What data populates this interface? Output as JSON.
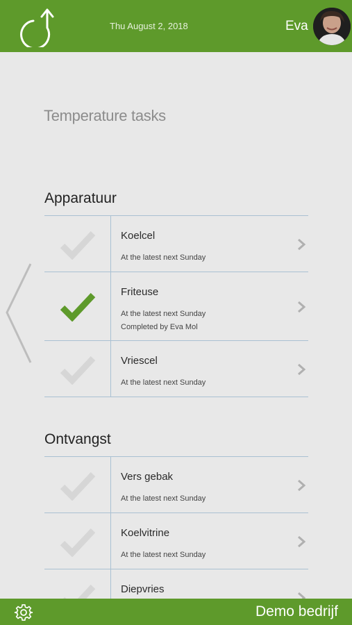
{
  "header": {
    "date": "Thu August 2, 2018",
    "user_name": "Eva",
    "logo_icon": "app-logo-icon",
    "avatar_icon": "user-avatar-photo"
  },
  "page": {
    "title": "Temperature tasks"
  },
  "sections": [
    {
      "title": "Apparatuur",
      "tasks": [
        {
          "name": "Koelcel",
          "due": "At the latest next Sunday",
          "completed_by": "",
          "done": false
        },
        {
          "name": "Friteuse",
          "due": "At the latest next Sunday",
          "completed_by": "Completed by Eva Mol",
          "done": true
        },
        {
          "name": "Vriescel",
          "due": "At the latest next Sunday",
          "completed_by": "",
          "done": false
        }
      ]
    },
    {
      "title": "Ontvangst",
      "tasks": [
        {
          "name": "Vers gebak",
          "due": "At the latest next Sunday",
          "completed_by": "",
          "done": false
        },
        {
          "name": "Koelvitrine",
          "due": "At the latest next Sunday",
          "completed_by": "",
          "done": false
        },
        {
          "name": "Diepvries",
          "due": "",
          "completed_by": "",
          "done": false
        }
      ]
    }
  ],
  "footer": {
    "company": "Demo bedrijf",
    "settings_icon": "gear-icon"
  },
  "colors": {
    "brand_green": "#5e9a2b",
    "check_done": "#5e9a2b",
    "check_pending": "#d6d6d6",
    "divider": "#a9c0d2",
    "background": "#e8e8e8"
  }
}
